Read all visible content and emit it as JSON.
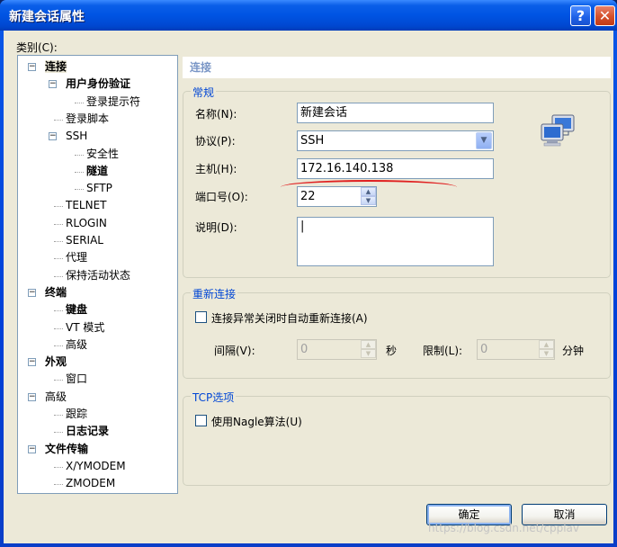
{
  "window": {
    "title": "新建会话属性"
  },
  "titlebar": {
    "help_glyph": "?",
    "close_glyph": "✕"
  },
  "category_label": "类别(C):",
  "tree": [
    {
      "label": "连接",
      "bold": true,
      "selected": true,
      "expander": "−"
    },
    {
      "label": "用户身份验证",
      "bold": true,
      "expander": "−"
    },
    {
      "label": "登录提示符",
      "bold": false
    },
    {
      "label": "登录脚本",
      "bold": false
    },
    {
      "label": "SSH",
      "bold": false,
      "expander": "−"
    },
    {
      "label": "安全性",
      "bold": false
    },
    {
      "label": "隧道",
      "bold": true
    },
    {
      "label": "SFTP",
      "bold": false
    },
    {
      "label": "TELNET",
      "bold": false
    },
    {
      "label": "RLOGIN",
      "bold": false
    },
    {
      "label": "SERIAL",
      "bold": false
    },
    {
      "label": "代理",
      "bold": false
    },
    {
      "label": "保持活动状态",
      "bold": false
    },
    {
      "label": "终端",
      "bold": true,
      "expander": "−"
    },
    {
      "label": "键盘",
      "bold": true
    },
    {
      "label": "VT 模式",
      "bold": false
    },
    {
      "label": "高级",
      "bold": false
    },
    {
      "label": "外观",
      "bold": true,
      "expander": "−"
    },
    {
      "label": "窗口",
      "bold": false
    },
    {
      "label": "高级",
      "bold": false,
      "expander": "−"
    },
    {
      "label": "跟踪",
      "bold": false
    },
    {
      "label": "日志记录",
      "bold": true
    },
    {
      "label": "文件传输",
      "bold": true,
      "expander": "−"
    },
    {
      "label": "X/YMODEM",
      "bold": false
    },
    {
      "label": "ZMODEM",
      "bold": false
    }
  ],
  "panel": {
    "header": "连接",
    "general": {
      "title": "常规",
      "name_label": "名称(N):",
      "name_value": "新建会话",
      "protocol_label": "协议(P):",
      "protocol_value": "SSH",
      "host_label": "主机(H):",
      "host_value": "172.16.140.138",
      "port_label": "端口号(O):",
      "port_value": "22",
      "desc_label": "说明(D):",
      "desc_value": "|"
    },
    "reconnect": {
      "title": "重新连接",
      "auto_reconnect_label": "连接异常关闭时自动重新连接(A)",
      "auto_reconnect_checked": false,
      "interval_label": "间隔(V):",
      "interval_value": "0",
      "interval_unit": "秒",
      "limit_label": "限制(L):",
      "limit_value": "0",
      "limit_unit": "分钟"
    },
    "tcp": {
      "title": "TCP选项",
      "nagle_label": "使用Nagle算法(U)",
      "nagle_checked": false
    }
  },
  "buttons": {
    "ok": "确定",
    "cancel": "取消"
  },
  "watermark": "https://blog.csdn.net/cpplav",
  "colors": {
    "titlebar": "#0054e3",
    "group_title": "#0046d5",
    "annotation_line": "#e02020"
  }
}
